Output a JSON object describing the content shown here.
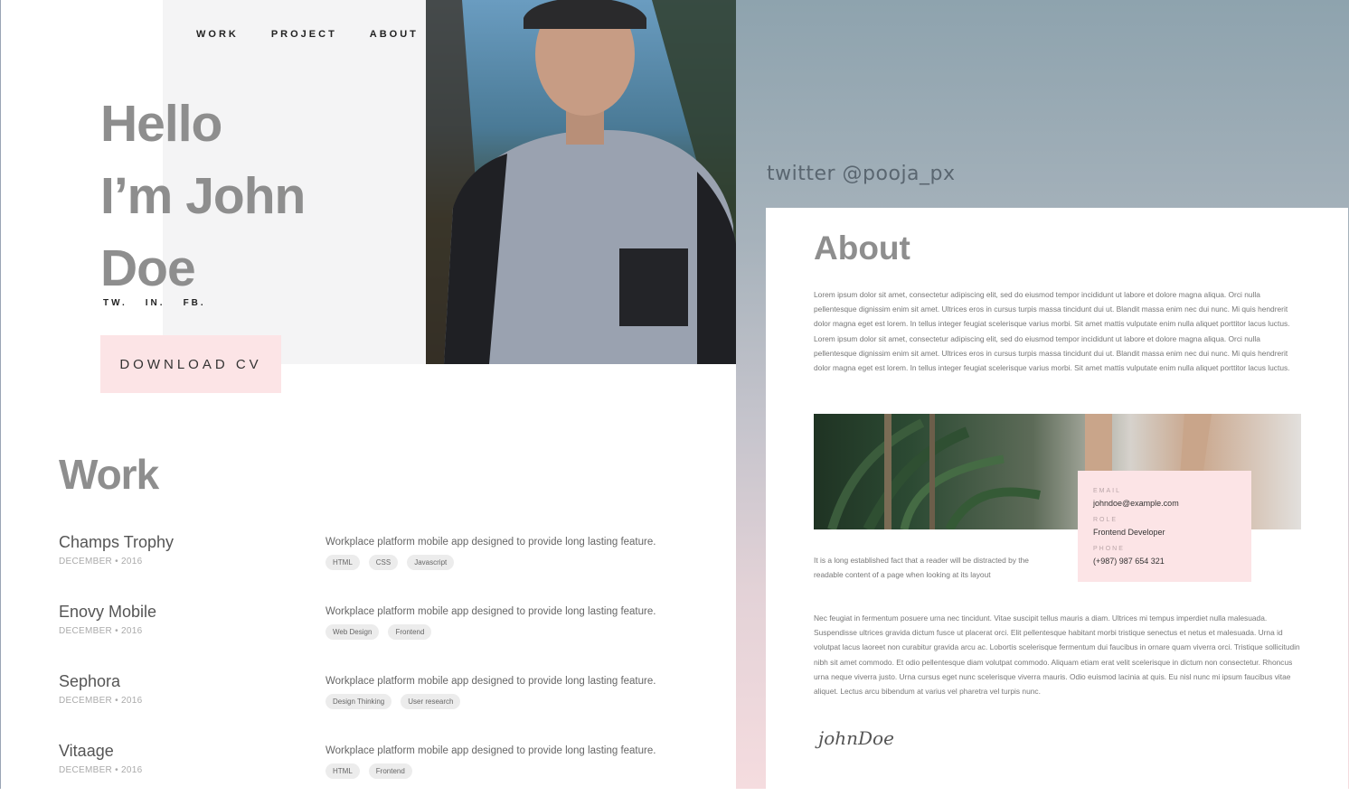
{
  "nav": {
    "items": [
      "WORK",
      "PROJECT",
      "ABOUT"
    ]
  },
  "hero": {
    "title_lines": [
      "Hello",
      "I’m John",
      "Doe"
    ],
    "socials": [
      "TW.",
      "IN.",
      "FB."
    ],
    "cv_button": "DOWNLOAD CV"
  },
  "work": {
    "title": "Work",
    "items": [
      {
        "name": "Champs Trophy",
        "date": "DECEMBER • 2016",
        "description": "Workplace platform mobile app designed to provide long lasting feature.",
        "tags": [
          "HTML",
          "CSS",
          "Javascript"
        ]
      },
      {
        "name": "Enovy Mobile",
        "date": "DECEMBER • 2016",
        "description": "Workplace platform mobile app designed to provide long lasting feature.",
        "tags": [
          "Web Design",
          "Frontend"
        ]
      },
      {
        "name": "Sephora",
        "date": "DECEMBER • 2016",
        "description": "Workplace platform mobile app designed to provide long lasting feature.",
        "tags": [
          "Design Thinking",
          "User research"
        ]
      },
      {
        "name": "Vitaage",
        "date": "DECEMBER • 2016",
        "description": "Workplace platform mobile app designed to provide long lasting feature.",
        "tags": [
          "HTML",
          "Frontend"
        ]
      }
    ]
  },
  "twitter": "twitter @pooja_px",
  "about": {
    "title": "About",
    "paragraph": "Lorem ipsum dolor sit amet, consectetur adipiscing elit, sed do eiusmod tempor incididunt ut labore et dolore magna aliqua. Orci nulla pellentesque dignissim enim sit amet. Ultrices eros in cursus turpis massa tincidunt dui ut. Blandit massa enim nec dui nunc. Mi quis hendrerit dolor magna eget est lorem. In tellus integer feugiat scelerisque varius morbi. Sit amet mattis vulputate enim nulla aliquet porttitor lacus luctus. Lorem ipsum dolor sit amet, consectetur adipiscing elit, sed do eiusmod tempor incididunt ut labore et dolore magna aliqua. Orci nulla pellentesque dignissim enim sit amet. Ultrices eros in cursus turpis massa tincidunt dui ut. Blandit massa enim nec dui nunc. Mi quis hendrerit dolor magna eget est lorem. In tellus integer feugiat scelerisque varius morbi. Sit amet mattis vulputate enim nulla aliquet porttitor lacus luctus.",
    "contact": {
      "email_label": "EMAIL",
      "email": "johndoe@example.com",
      "role_label": "ROLE",
      "role": "Frontend Developer",
      "phone_label": "PHONE",
      "phone": "(+987) 987 654 321"
    },
    "short_text": "It is a long established fact that a reader will be distracted by the readable content of a page when looking at its layout",
    "paragraph2": "Nec feugiat in fermentum posuere urna nec tincidunt. Vitae suscipit tellus mauris a diam. Ultrices mi tempus imperdiet nulla malesuada. Suspendisse ultrices gravida dictum fusce ut placerat orci. Elit pellentesque habitant morbi tristique senectus et netus et malesuada. Urna id volutpat lacus laoreet non curabitur gravida arcu ac. Lobortis scelerisque fermentum dui faucibus in ornare quam viverra orci. Tristique sollicitudin nibh sit amet commodo. Et odio pellentesque diam volutpat commodo. Aliquam etiam erat velit scelerisque in dictum non consectetur. Rhoncus urna neque viverra justo. Urna cursus eget nunc scelerisque viverra mauris. Odio euismod lacinia at quis. Eu nisl nunc mi ipsum faucibus vitae aliquet. Lectus arcu bibendum at varius vel pharetra vel turpis nunc.",
    "signature": "johnDoe"
  }
}
